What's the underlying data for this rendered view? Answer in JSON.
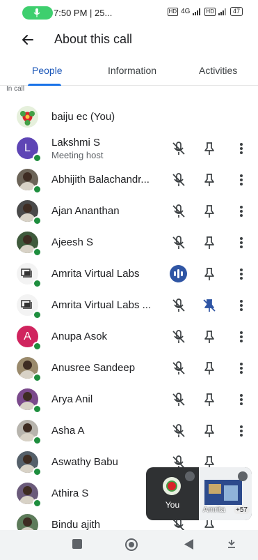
{
  "status_bar": {
    "time": "7:50 PM | 25...",
    "network": "4G",
    "battery": "47"
  },
  "header": {
    "title": "About this call"
  },
  "tabs": [
    {
      "label": "People"
    },
    {
      "label": "Information"
    },
    {
      "label": "Activities"
    }
  ],
  "section_label": "In call",
  "participants": [
    {
      "name": "baiju ec (You)",
      "role": ""
    },
    {
      "name": "Lakshmi S",
      "role": "Meeting host",
      "avatar_letter": "L",
      "avatar_color": "#5e45b5"
    },
    {
      "name": "Abhijith Balachandr...",
      "role": ""
    },
    {
      "name": "Ajan Ananthan",
      "role": ""
    },
    {
      "name": "Ajeesh S",
      "role": ""
    },
    {
      "name": "Amrita Virtual Labs",
      "role": ""
    },
    {
      "name": "Amrita Virtual Labs ...",
      "role": ""
    },
    {
      "name": "Anupa Asok",
      "role": "",
      "avatar_letter": "A",
      "avatar_color": "#d0245e"
    },
    {
      "name": "Anusree Sandeep",
      "role": ""
    },
    {
      "name": "Arya Anil",
      "role": ""
    },
    {
      "name": "Asha A",
      "role": ""
    },
    {
      "name": "Aswathy Babu",
      "role": ""
    },
    {
      "name": "Athira S",
      "role": ""
    },
    {
      "name": "Bindu ajith",
      "role": ""
    }
  ],
  "floating_view": {
    "self_label": "You",
    "share_label": "Amrita",
    "extra_count": "+57"
  },
  "colors": {
    "accent": "#1a73e8",
    "speaking": "#2f55a4",
    "online": "#1e8e3e"
  }
}
